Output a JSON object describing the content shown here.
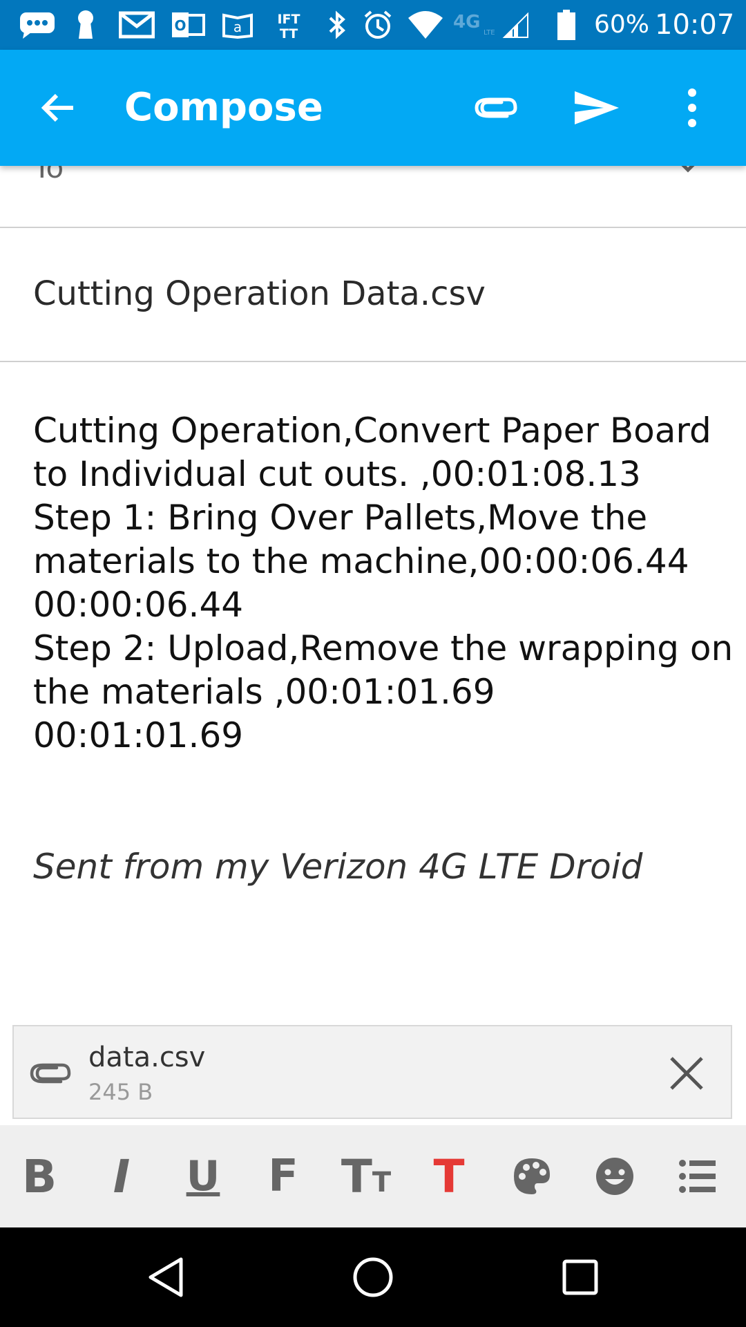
{
  "status_bar": {
    "battery_percent": "60%",
    "time": "10:07",
    "network_badge": "4G",
    "network_sub": "LTE",
    "icons": [
      "chat-icon",
      "keyhole-icon",
      "gmail-icon",
      "outlook-icon",
      "kindle-icon",
      "ifttt-icon",
      "bluetooth-icon",
      "alarm-icon",
      "wifi-icon",
      "4g-lte-icon",
      "signal-icon",
      "battery-icon"
    ],
    "outlook_letter": "O",
    "kindle_letter": "a",
    "ifttt_top": "IFT",
    "ifttt_bottom": "TT"
  },
  "app_bar": {
    "title": "Compose",
    "icons": [
      "back-arrow-icon",
      "attach-icon",
      "send-icon",
      "more-vert-icon"
    ]
  },
  "compose": {
    "to_label": "To",
    "subject": "Cutting Operation Data.csv",
    "body_lines": [
      "Cutting Operation,Convert Paper Board",
      "to Individual cut outs. ,00:01:08.13",
      "Step 1: Bring Over Pallets,Move the",
      "materials to the machine,00:00:06.44",
      "00:00:06.44",
      "Step 2: Upload,Remove the wrapping on",
      "the materials ,00:01:01.69",
      "00:01:01.69"
    ],
    "signature": "Sent from my Verizon 4G LTE Droid"
  },
  "attachment": {
    "file_name": "data.csv",
    "file_size": "245 B"
  },
  "format_toolbar": {
    "bold": "B",
    "italic": "I",
    "underline": "U",
    "font": "F",
    "size_big": "T",
    "size_small": "T",
    "text_color": "T",
    "text_color_hex": "#E53935",
    "icons": [
      "palette-icon",
      "emoji-icon",
      "list-icon"
    ]
  },
  "colors": {
    "status_bar": "#0277BD",
    "app_bar": "#03A9F4",
    "format_bar": "#EFEFEF",
    "nav_bar": "#000000"
  },
  "nav_bar": {
    "icons": [
      "back-triangle-icon",
      "home-circle-icon",
      "recents-square-icon"
    ]
  }
}
